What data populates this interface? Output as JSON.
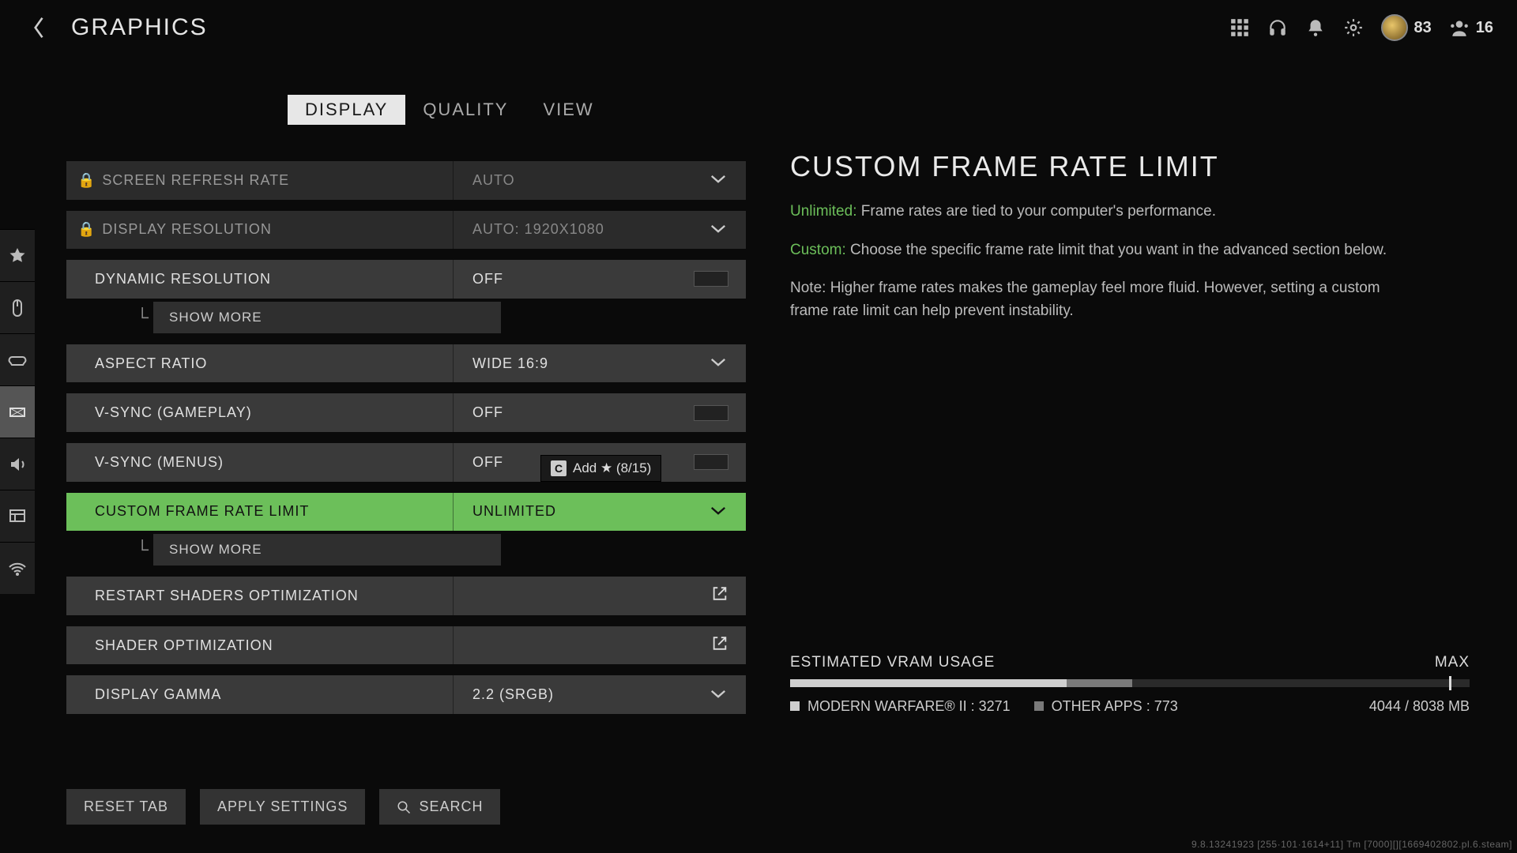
{
  "header": {
    "title": "GRAPHICS",
    "currency": "83",
    "party": "16"
  },
  "tabs": {
    "display": "DISPLAY",
    "quality": "QUALITY",
    "view": "VIEW"
  },
  "rows": {
    "refresh": {
      "label": "SCREEN REFRESH RATE",
      "value": "AUTO"
    },
    "resolution": {
      "label": "DISPLAY RESOLUTION",
      "value": "AUTO: 1920X1080"
    },
    "dynres": {
      "label": "DYNAMIC RESOLUTION",
      "value": "OFF"
    },
    "aspect": {
      "label": "ASPECT RATIO",
      "value": "WIDE 16:9"
    },
    "vsync_game": {
      "label": "V-SYNC (GAMEPLAY)",
      "value": "OFF"
    },
    "vsync_menu": {
      "label": "V-SYNC (MENUS)",
      "value": "OFF"
    },
    "frame_limit": {
      "label": "CUSTOM FRAME RATE LIMIT",
      "value": "UNLIMITED"
    },
    "restart_shader": {
      "label": "RESTART SHADERS OPTIMIZATION",
      "value": ""
    },
    "shader_opt": {
      "label": "SHADER OPTIMIZATION",
      "value": ""
    },
    "gamma": {
      "label": "DISPLAY GAMMA",
      "value": "2.2 (SRGB)"
    }
  },
  "show_more": "SHOW MORE",
  "fav": {
    "key": "C",
    "text": "Add ★ (8/15)"
  },
  "detail": {
    "title": "CUSTOM FRAME RATE LIMIT",
    "p1_kw": "Unlimited:",
    "p1": " Frame rates are tied to your computer's performance.",
    "p2_kw": "Custom:",
    "p2": " Choose the specific frame rate limit that you want in the advanced section below.",
    "p3": "Note: Higher frame rates makes the gameplay feel more fluid. However, setting a custom frame rate limit can help prevent instability."
  },
  "vram": {
    "title": "ESTIMATED VRAM USAGE",
    "max": "MAX",
    "game_label": "MODERN WARFARE® II : 3271",
    "other_label": "OTHER APPS : 773",
    "total": "4044 / 8038 MB",
    "game_pct": 40.7,
    "other_pct": 9.6,
    "max_pct": 97
  },
  "footer": {
    "reset": "RESET TAB",
    "apply": "APPLY SETTINGS",
    "search": "SEARCH"
  },
  "build": "9.8.13241923 [255·101·1614+11]  Tm [7000][][1669402802.pl.6.steam]"
}
